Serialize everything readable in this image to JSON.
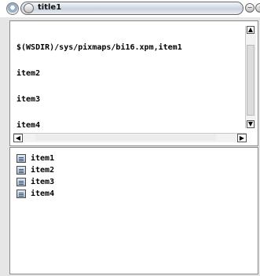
{
  "window": {
    "title": "title1"
  },
  "upper_text": {
    "lines": [
      "$(WSDIR)/sys/pixmaps/bi16.xpm,item1",
      "item2",
      "item3",
      "item4"
    ]
  },
  "list": {
    "items": [
      {
        "label": "item1",
        "icon": "file-icon"
      },
      {
        "label": "item2",
        "icon": "file-icon"
      },
      {
        "label": "item3",
        "icon": "file-icon"
      },
      {
        "label": "item4",
        "icon": "file-icon"
      }
    ]
  },
  "titlebar_buttons": {
    "minimize": "−",
    "maximize": "◦",
    "close": "×"
  },
  "scroll": {
    "up": "▲",
    "down": "▼",
    "left": "◀",
    "right": "▶"
  }
}
